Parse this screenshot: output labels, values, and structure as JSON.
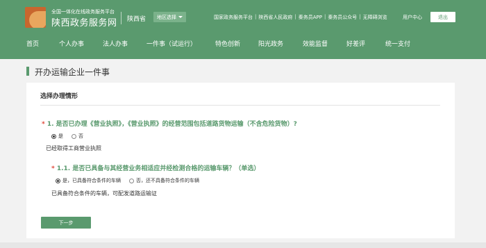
{
  "header": {
    "brand_sub": "全国一体化在线政务服务平台",
    "brand_main": "陕西政务服务网",
    "province": "陕西省",
    "region_select": "地区选择",
    "top_links": [
      "国家政务服务平台",
      "陕西省人民政府",
      "秦务员APP",
      "秦务员公众号",
      "无障碍浏览"
    ],
    "user_center": "用户中心",
    "logout": "退出"
  },
  "nav": {
    "items": [
      "首页",
      "个人办事",
      "法人办事",
      "一件事（试运行）",
      "特色创新",
      "阳光政务",
      "效能监督",
      "好差评",
      "统一支付"
    ]
  },
  "page": {
    "title": "开办运输企业一件事"
  },
  "form": {
    "section_title": "选择办理情形",
    "q1": {
      "marker": "*",
      "text": "1. 是否已办理《营业执照》，《营业执照》的经营范围包括道路货物运输（不含危险货物）?",
      "options": [
        "是",
        "否"
      ],
      "selected": "是",
      "answer": "已经取得工商营业执照"
    },
    "q2": {
      "marker": "*",
      "text": "1.1. 是否已具备与其经营业务相适应并经检测合格的运输车辆？（单选）",
      "options": [
        "是，已具备符合条件的车辆",
        "否，还不具备符合条件的车辆"
      ],
      "selected": "是，已具备符合条件的车辆",
      "answer": "已具备符合条件的车辆，可配发道路运输证"
    },
    "next_button": "下一步"
  },
  "colors": {
    "primary": "#5a9a6e",
    "required": "#e04a3c",
    "background": "#f2f2f2"
  }
}
